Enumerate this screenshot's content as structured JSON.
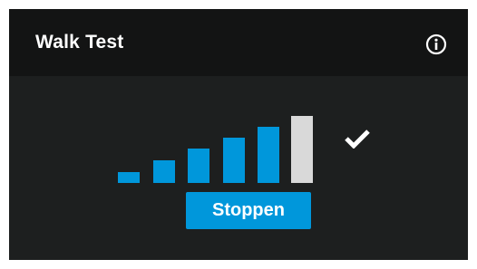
{
  "header": {
    "title": "Walk Test",
    "info_icon": "info-circle-icon"
  },
  "signal": {
    "levels_total": 6,
    "levels_active": 5,
    "active_color": "#0097db",
    "inactive_color": "#d9d9d9",
    "status_icon": "checkmark-icon"
  },
  "actions": {
    "stop_label": "Stoppen",
    "button_color": "#0097db"
  },
  "colors": {
    "panel_bg": "#1d1f1f",
    "header_bg": "#131414",
    "text": "#ffffff"
  }
}
